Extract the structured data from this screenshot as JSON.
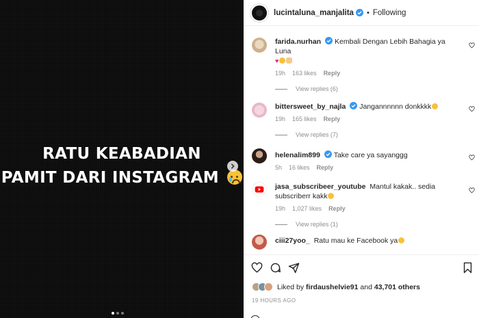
{
  "media": {
    "line1": "RATU KEABADIAN",
    "line2": "PAMIT DARI INSTAGRAM",
    "emoji": "crying-face",
    "carousel": {
      "count": 3,
      "active_index": 0
    }
  },
  "header": {
    "username": "lucintaluna_manjalita",
    "separator": "•",
    "follow_label": "Following"
  },
  "comments": [
    {
      "username": "farida.nurhan",
      "text": "Kembali Dengan Lebih Bahagia ya Luna",
      "text2": "",
      "time": "19h",
      "likes": "163 likes",
      "reply": "Reply",
      "view_replies": "View replies (6)"
    },
    {
      "username": "bittersweet_by_najla",
      "text": "Jangannnnnn donkkkk",
      "text2": "",
      "time": "19h",
      "likes": "165 likes",
      "reply": "Reply",
      "view_replies": "View replies (7)"
    },
    {
      "username": "helenalim899",
      "text": "Take care ya sayanggg",
      "text2": "",
      "time": "5h",
      "likes": "16 likes",
      "reply": "Reply",
      "view_replies": ""
    },
    {
      "username": "jasa_subscribeer_youtube",
      "text": "Mantul kakak.. sedia",
      "text2": "subscriberr kakk",
      "time": "19h",
      "likes": "1,027 likes",
      "reply": "Reply",
      "view_replies": "View replies (1)"
    },
    {
      "username": "ciii27yoo_",
      "text": "Ratu mau ke Facebook ya",
      "text2": "",
      "time": "",
      "likes": "",
      "reply": "",
      "view_replies": ""
    }
  ],
  "likes": {
    "prefix": "Liked by",
    "user": "firdaushelvie91",
    "middle": "and",
    "others": "43,701 others"
  },
  "timestamp": "19 HOURS AGO",
  "colors": {
    "verified": "#3897f0",
    "heart_red": "#e0245e",
    "muted": "#8e8e8e"
  }
}
